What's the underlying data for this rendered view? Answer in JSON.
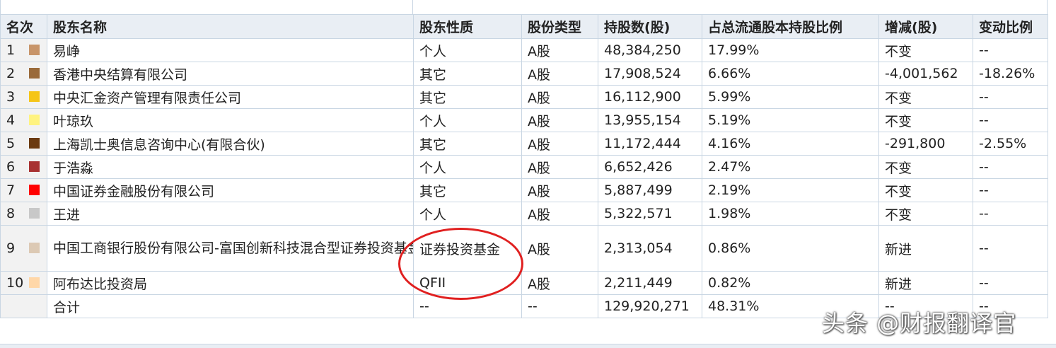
{
  "table": {
    "headers": [
      "名次",
      "股东名称",
      "股东性质",
      "股份类型",
      "持股数(股)",
      "占总流通股本持股比例",
      "增减(股)",
      "变动比例"
    ],
    "rows": [
      {
        "rank": "1",
        "color": "#c8956a",
        "name": "易峥",
        "nature": "个人",
        "share_type": "A股",
        "shares": "48,384,250",
        "ratio": "17.99%",
        "change": "不变",
        "change_ratio": "--"
      },
      {
        "rank": "2",
        "color": "#9a6a3a",
        "name": "香港中央结算有限公司",
        "nature": "其它",
        "share_type": "A股",
        "shares": "17,908,524",
        "ratio": "6.66%",
        "change": "-4,001,562",
        "change_ratio": "-18.26%"
      },
      {
        "rank": "3",
        "color": "#f5c518",
        "name": "中央汇金资产管理有限责任公司",
        "nature": "其它",
        "share_type": "A股",
        "shares": "16,112,900",
        "ratio": "5.99%",
        "change": "不变",
        "change_ratio": "--"
      },
      {
        "rank": "4",
        "color": "#fff380",
        "name": "叶琼玖",
        "nature": "个人",
        "share_type": "A股",
        "shares": "13,955,154",
        "ratio": "5.19%",
        "change": "不变",
        "change_ratio": "--"
      },
      {
        "rank": "5",
        "color": "#6b3a10",
        "name": "上海凯士奥信息咨询中心(有限合伙)",
        "nature": "其它",
        "share_type": "A股",
        "shares": "11,172,444",
        "ratio": "4.16%",
        "change": "-291,800",
        "change_ratio": "-2.55%"
      },
      {
        "rank": "6",
        "color": "#a83232",
        "name": "于浩淼",
        "nature": "个人",
        "share_type": "A股",
        "shares": "6,652,426",
        "ratio": "2.47%",
        "change": "不变",
        "change_ratio": "--"
      },
      {
        "rank": "7",
        "color": "#ff0000",
        "name": "中国证券金融股份有限公司",
        "nature": "其它",
        "share_type": "A股",
        "shares": "5,887,499",
        "ratio": "2.19%",
        "change": "不变",
        "change_ratio": "--"
      },
      {
        "rank": "8",
        "color": "#c8c8c8",
        "name": "王进",
        "nature": "个人",
        "share_type": "A股",
        "shares": "5,322,571",
        "ratio": "1.98%",
        "change": "不变",
        "change_ratio": "--"
      },
      {
        "rank": "9",
        "color": "#dcc9b4",
        "name": "中国工商银行股份有限公司-富国创新科技混合型证券投资基金",
        "nature": "证券投资基金",
        "share_type": "A股",
        "shares": "2,313,054",
        "ratio": "0.86%",
        "change": "新进",
        "change_ratio": "--"
      },
      {
        "rank": "10",
        "color": "#ffd7a8",
        "name": "阿布达比投资局",
        "nature": "QFII",
        "share_type": "A股",
        "shares": "2,211,449",
        "ratio": "0.82%",
        "change": "新进",
        "change_ratio": "--"
      }
    ],
    "total": {
      "label": "合计",
      "nature": "--",
      "share_type": "--",
      "shares": "129,920,271",
      "ratio": "48.31%",
      "change": "--",
      "change_ratio": "--"
    }
  },
  "watermark": "头条 @财报翻译官"
}
